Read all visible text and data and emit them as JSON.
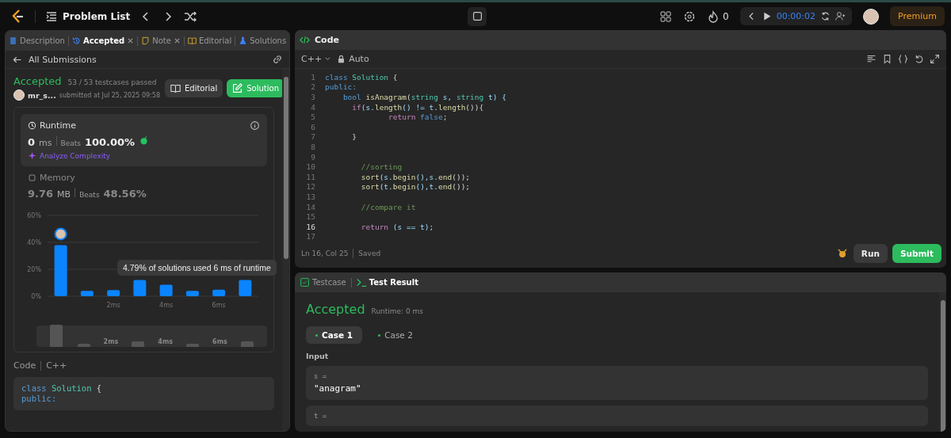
{
  "topbar": {
    "title": "Problem List",
    "streak": "0",
    "timer": "00:00:02",
    "premium": "Premium"
  },
  "left_tabs": [
    {
      "label": "Description",
      "selected": false,
      "closable": false,
      "kind": "description"
    },
    {
      "label": "Accepted",
      "selected": true,
      "closable": true,
      "kind": "submission"
    },
    {
      "label": "Note",
      "selected": false,
      "closable": true,
      "kind": "note"
    },
    {
      "label": "Editorial",
      "selected": false,
      "closable": false,
      "kind": "editorial"
    },
    {
      "label": "Solutions",
      "selected": false,
      "closable": false,
      "kind": "solutions"
    }
  ],
  "submission": {
    "back": "All Submissions",
    "status": "Accepted",
    "cases": "53 / 53 testcases passed",
    "user": "mr_s...",
    "submitted": "submitted at Jul 25, 2025 09:58",
    "buttons": [
      {
        "label": "Editorial",
        "kind": "secondary"
      },
      {
        "label": "Solution",
        "kind": "primary"
      }
    ]
  },
  "runtime": {
    "title": "Runtime",
    "value": "0",
    "unit": "ms",
    "beats_label": "Beats",
    "beats": "100.00%",
    "analyze": "Analyze Complexity"
  },
  "memory": {
    "title": "Memory",
    "value": "9.76",
    "unit": "MB",
    "beats_label": "Beats",
    "beats": "48.56%"
  },
  "chart_data": {
    "type": "bar",
    "x": [
      0,
      1,
      2,
      3,
      4,
      5,
      6,
      7
    ],
    "xlim": [
      -0.5,
      7.5
    ],
    "values": [
      38,
      4,
      4.5,
      12,
      8.5,
      4,
      4.8,
      12
    ],
    "xticks": [
      {
        "value": 2,
        "label": "2ms"
      },
      {
        "value": 4,
        "label": "4ms"
      },
      {
        "value": 6,
        "label": "6ms"
      }
    ],
    "yticks": [
      {
        "value": 0,
        "label": "0%"
      },
      {
        "value": 20,
        "label": "20%"
      },
      {
        "value": 40,
        "label": "40%"
      },
      {
        "value": 60,
        "label": "60%"
      }
    ],
    "ylim": [
      0,
      60
    ],
    "annotations": [
      "4.79% of solutions used 6 ms of runtime"
    ]
  },
  "navigator_labels": [
    "2ms",
    "4ms",
    "6ms"
  ],
  "submitted_code": {
    "label": "Code",
    "language": "C++",
    "lines": [
      [
        {
          "text": "class ",
          "kind": "kw"
        },
        {
          "text": "Solution",
          "kind": "type"
        },
        {
          "text": " {",
          "kind": "plain"
        }
      ],
      [
        {
          "text": "public:",
          "kind": "kw"
        }
      ]
    ]
  },
  "editor": {
    "title": "Code",
    "language": "C++",
    "mode": "Auto",
    "status": "Ln 16, Col 25",
    "saved": "Saved",
    "lines": [
      {
        "number": "1",
        "current": false,
        "tokens": [
          {
            "text": "class ",
            "kind": "kw"
          },
          {
            "text": "Solution",
            "kind": "type"
          },
          {
            "text": " {",
            "kind": "plain"
          }
        ]
      },
      {
        "number": "2",
        "current": false,
        "tokens": [
          {
            "text": "public:",
            "kind": "kw"
          }
        ]
      },
      {
        "number": "3",
        "current": false,
        "tokens": [
          {
            "text": "    bool ",
            "kind": "kw"
          },
          {
            "text": "isAnagram",
            "kind": "fn"
          },
          {
            "text": "(",
            "kind": "plain"
          },
          {
            "text": "string",
            "kind": "type"
          },
          {
            "text": " s, ",
            "kind": "var"
          },
          {
            "text": "string",
            "kind": "type"
          },
          {
            "text": " t) {",
            "kind": "var"
          }
        ]
      },
      {
        "number": "4",
        "current": false,
        "tokens": [
          {
            "text": "      if",
            "kind": "ctl"
          },
          {
            "text": "(s.",
            "kind": "var"
          },
          {
            "text": "length",
            "kind": "fn"
          },
          {
            "text": "() != t.",
            "kind": "var"
          },
          {
            "text": "length",
            "kind": "fn"
          },
          {
            "text": "()){",
            "kind": "plain"
          }
        ]
      },
      {
        "number": "5",
        "current": false,
        "tokens": [
          {
            "text": "              return ",
            "kind": "ctl"
          },
          {
            "text": "false",
            "kind": "kw"
          },
          {
            "text": ";",
            "kind": "plain"
          }
        ]
      },
      {
        "number": "6",
        "current": false
      },
      {
        "number": "7",
        "current": false,
        "tokens": [
          {
            "text": "      }",
            "kind": "plain"
          }
        ]
      },
      {
        "number": "8",
        "current": false
      },
      {
        "number": "9",
        "current": false
      },
      {
        "number": "10",
        "current": false,
        "tokens": [
          {
            "text": "        //sorting",
            "kind": "cmt"
          }
        ]
      },
      {
        "number": "11",
        "current": false,
        "tokens": [
          {
            "text": "        sort",
            "kind": "fn"
          },
          {
            "text": "(s.",
            "kind": "var"
          },
          {
            "text": "begin",
            "kind": "fn"
          },
          {
            "text": "(),s.",
            "kind": "var"
          },
          {
            "text": "end",
            "kind": "fn"
          },
          {
            "text": "());",
            "kind": "plain"
          }
        ]
      },
      {
        "number": "12",
        "current": false,
        "tokens": [
          {
            "text": "        sort",
            "kind": "fn"
          },
          {
            "text": "(t.",
            "kind": "var"
          },
          {
            "text": "begin",
            "kind": "fn"
          },
          {
            "text": "(),t.",
            "kind": "var"
          },
          {
            "text": "end",
            "kind": "fn"
          },
          {
            "text": "());",
            "kind": "plain"
          }
        ]
      },
      {
        "number": "13",
        "current": false
      },
      {
        "number": "14",
        "current": false,
        "tokens": [
          {
            "text": "        //compare it",
            "kind": "cmt"
          }
        ]
      },
      {
        "number": "15",
        "current": false
      },
      {
        "number": "16",
        "current": true,
        "tokens": [
          {
            "text": "        return ",
            "kind": "ctl"
          },
          {
            "text": "(s == t);",
            "kind": "var"
          }
        ]
      },
      {
        "number": "17",
        "current": false
      }
    ],
    "buttons": [
      {
        "label": "Run",
        "kind": "secondary"
      },
      {
        "label": "Submit",
        "kind": "primary"
      }
    ]
  },
  "result_tabs": [
    {
      "label": "Testcase",
      "selected": false,
      "kind": "testcase"
    },
    {
      "label": "Test Result",
      "selected": true,
      "kind": "result"
    }
  ],
  "result": {
    "status": "Accepted",
    "runtime": "Runtime: 0 ms",
    "cases": [
      {
        "label": "Case 1",
        "selected": true
      },
      {
        "label": "Case 2",
        "selected": false
      }
    ],
    "input_label": "Input",
    "inputs": [
      {
        "name": "s =",
        "value": "\"anagram\""
      },
      {
        "name": "t ="
      }
    ]
  }
}
